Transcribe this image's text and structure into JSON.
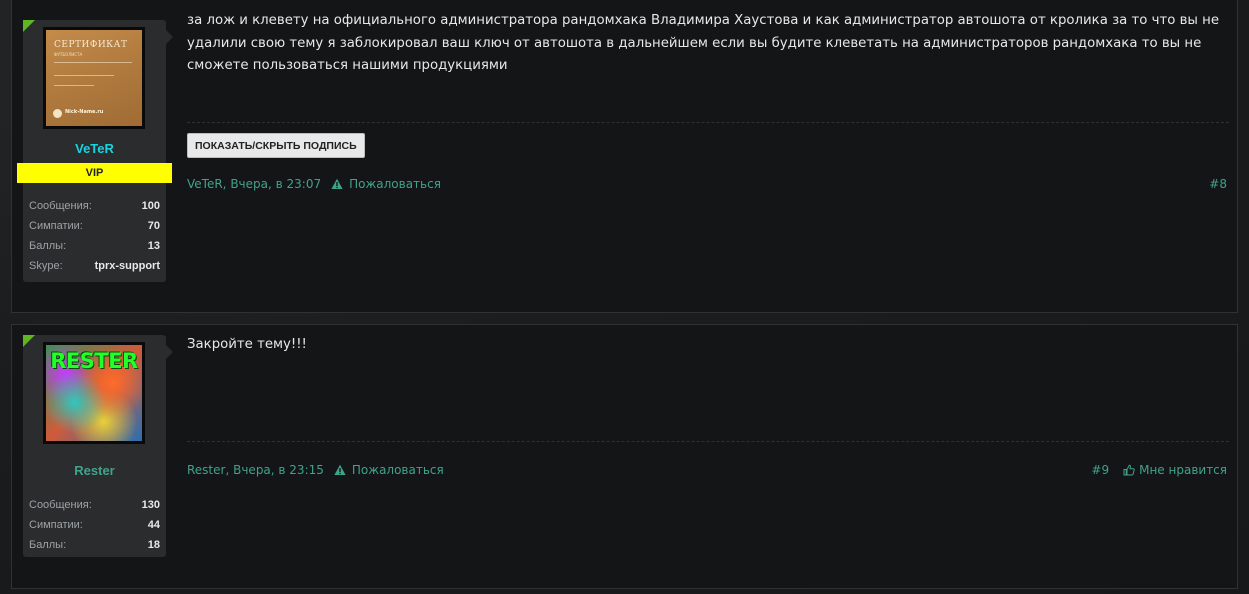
{
  "posts": [
    {
      "user": {
        "name": "VeTeR",
        "badge": "VIP",
        "avatar_text": {
          "title": "СЕРТИФИКАТ",
          "subtitle": "ФУТБОЛИСТА",
          "site": "Nick-Name.ru"
        },
        "stats": [
          {
            "label": "Сообщения:",
            "value": "100"
          },
          {
            "label": "Симпатии:",
            "value": "70"
          },
          {
            "label": "Баллы:",
            "value": "13"
          },
          {
            "label": "Skype:",
            "value": "tprx-support"
          }
        ]
      },
      "message": "за лож и клевету на официального администратора рандомхака Владимира Хаустова и как администратор автошота от кролика за то что вы не удалили свою тему я заблокировал ваш ключ от автошота в дальнейшем если вы будите клеветать на администраторов рандомхака то вы не сможете пользоваться нашими продукциями",
      "signature_button": "ПОКАЗАТЬ/СКРЫТЬ ПОДПИСЬ",
      "meta": {
        "author": "VeTeR",
        "sep": ", ",
        "time": "Вчера, в 23:07",
        "report": "Пожаловаться",
        "number": "#8"
      }
    },
    {
      "user": {
        "name": "Rester",
        "avatar_text": {
          "title": "RESTER"
        },
        "stats": [
          {
            "label": "Сообщения:",
            "value": "130"
          },
          {
            "label": "Симпатии:",
            "value": "44"
          },
          {
            "label": "Баллы:",
            "value": "18"
          }
        ]
      },
      "message": "Закройте тему!!!",
      "meta": {
        "author": "Rester",
        "sep": ", ",
        "time": "Вчера, в 23:15",
        "report": "Пожаловаться",
        "number": "#9",
        "like": "Мне нравится"
      }
    }
  ],
  "colors": {
    "accent": "#3fa38a",
    "username_vip": "#19d4e0",
    "badge_bg": "#ffff00",
    "corner": "#5fb623"
  },
  "icons": {
    "report": "warning-triangle-icon",
    "like": "thumbs-up-icon"
  }
}
